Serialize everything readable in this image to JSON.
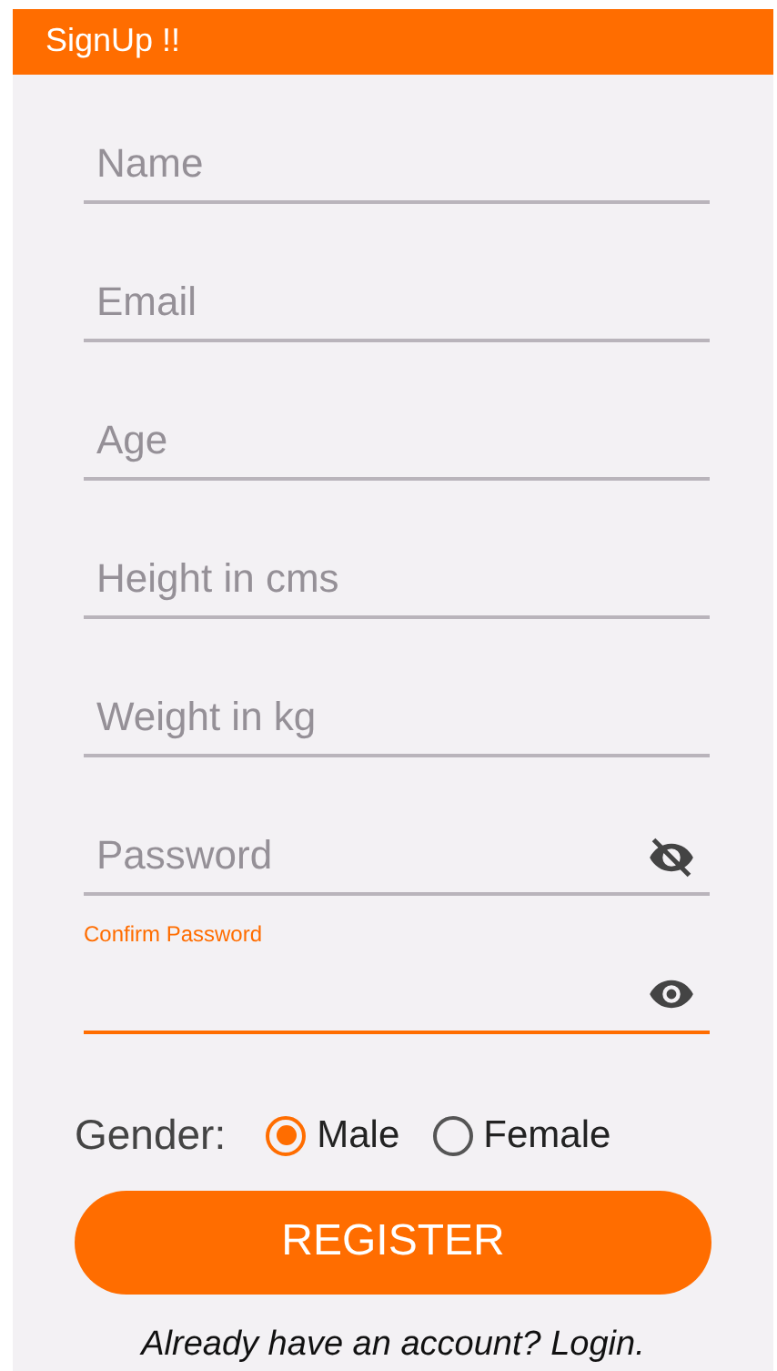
{
  "app_bar": {
    "title": "SignUp !!"
  },
  "fields": [
    {
      "kind": "text",
      "placeholder": "Name"
    },
    {
      "kind": "text",
      "placeholder": "Email"
    },
    {
      "kind": "text",
      "placeholder": "Age"
    },
    {
      "kind": "text",
      "placeholder": "Height in cms"
    },
    {
      "kind": "text",
      "placeholder": "Weight in kg"
    },
    {
      "kind": "password",
      "placeholder": "Password",
      "focused": false,
      "password_visible": false
    },
    {
      "kind": "password",
      "label": "Confirm Password",
      "focused": true,
      "password_visible": true
    }
  ],
  "gender": {
    "label": "Gender:",
    "options": [
      {
        "label": "Male",
        "selected": true
      },
      {
        "label": "Female",
        "selected": false
      }
    ]
  },
  "register_button": "REGISTER",
  "login_link": "Already have an account? Login."
}
